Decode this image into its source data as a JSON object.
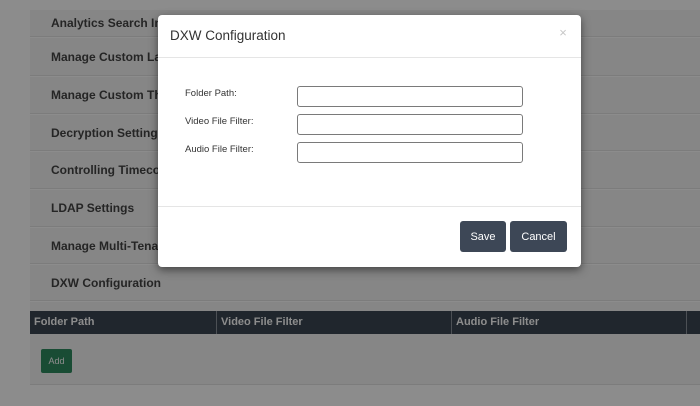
{
  "panels": [
    {
      "title": "Analytics Search Index"
    },
    {
      "title": "Manage Custom Languages"
    },
    {
      "title": "Manage Custom Themes"
    },
    {
      "title": "Decryption Settings"
    },
    {
      "title": "Controlling Timecode"
    },
    {
      "title": "LDAP Settings"
    },
    {
      "title": "Manage Multi-Tenant"
    },
    {
      "title": "DXW Configuration"
    }
  ],
  "grid": {
    "columns": [
      "Folder Path",
      "Video File Filter",
      "Audio File Filter"
    ]
  },
  "add_label": "Add",
  "modal": {
    "title": "DXW Configuration",
    "close_glyph": "×",
    "fields": [
      {
        "label": "Folder Path:",
        "value": ""
      },
      {
        "label": "Video File Filter:",
        "value": ""
      },
      {
        "label": "Audio File Filter:",
        "value": ""
      }
    ],
    "save_label": "Save",
    "cancel_label": "Cancel"
  },
  "colors": {
    "header_dark": "#3b4653",
    "add_green": "#2f8a5f",
    "button_dark": "#3d4756"
  }
}
